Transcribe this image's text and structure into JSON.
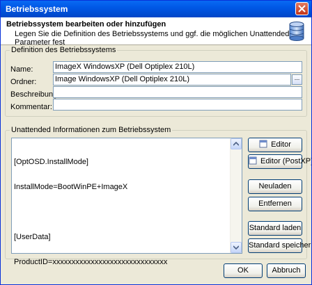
{
  "window": {
    "title": "Betriebssystem"
  },
  "header": {
    "title": "Betriebssystem bearbeiten oder hinzufügen",
    "subtitle": "Legen Sie die Definition des Betriebssystems und ggf. die möglichen Unattended Parameter fest",
    "icon": "database-icon"
  },
  "definition": {
    "legend": "Definition des Betriebssystems",
    "name_label": "Name:",
    "name_value": "ImageX WindowsXP (Dell Optiplex 210L)",
    "folder_label": "Ordner:",
    "folder_value": "Image WindowsXP (Dell Optiplex 210L)",
    "browse_label": "...",
    "description_label": "Beschreibung:",
    "description_value": "",
    "comment_label": "Kommentar:",
    "comment_value": ""
  },
  "unattended": {
    "legend": "Unattended Informationen zum Betriebssystem",
    "lines": [
      "[OptOSD.InstallMode]",
      "InstallMode=BootWinPE+ImageX",
      "",
      "[UserData]",
      "ProductID=xxxxxxxxxxxxxxxxxxxxxxxxxxxxxx"
    ],
    "buttons": {
      "editor": "Editor",
      "editor_postxp": "Editor (PostXP)",
      "reload": "Neuladen",
      "remove": "Entfernen",
      "load_default": "Standard laden",
      "save_default": "Standard speichern"
    }
  },
  "footer": {
    "ok": "OK",
    "cancel": "Abbruch"
  },
  "colors": {
    "titlebar": "#0058E6",
    "dialog_bg": "#ECE9D8",
    "border": "#7F9DB9"
  }
}
